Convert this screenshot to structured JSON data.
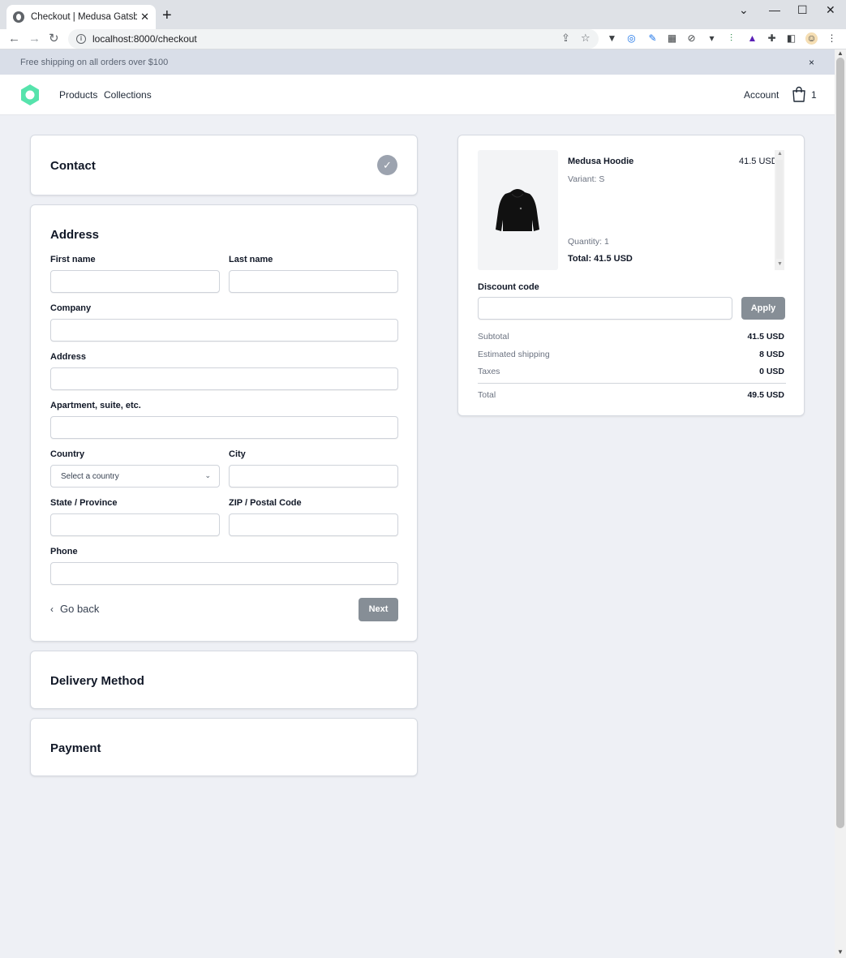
{
  "browser": {
    "tab_title": "Checkout | Medusa Gatsby Starter",
    "tab_close": "✕",
    "new_tab": "+",
    "url": "localhost:8000/checkout",
    "window_controls": [
      "⌄",
      "—",
      "☐",
      "✕"
    ]
  },
  "announcement": {
    "text": "Free shipping on all orders over $100",
    "close": "×"
  },
  "header": {
    "nav": [
      "Products",
      "Collections"
    ],
    "account": "Account",
    "cart_count": "1",
    "logo_color": "#56e3ac"
  },
  "checkout": {
    "contact": {
      "title": "Contact",
      "check": "✓"
    },
    "address": {
      "title": "Address",
      "first_name_label": "First name",
      "last_name_label": "Last name",
      "company_label": "Company",
      "address_label": "Address",
      "apartment_label": "Apartment, suite, etc.",
      "country_label": "Country",
      "country_placeholder": "Select a country",
      "city_label": "City",
      "state_label": "State / Province",
      "zip_label": "ZIP / Postal Code",
      "phone_label": "Phone",
      "go_back": "Go back",
      "next": "Next"
    },
    "delivery": {
      "title": "Delivery Method"
    },
    "payment": {
      "title": "Payment"
    }
  },
  "summary": {
    "item": {
      "name": "Medusa Hoodie",
      "price": "41.5 USD",
      "variant": "Variant: S",
      "quantity": "Quantity: 1",
      "total": "Total: 41.5 USD"
    },
    "discount_label": "Discount code",
    "apply": "Apply",
    "rows": [
      {
        "label": "Subtotal",
        "value": "41.5 USD"
      },
      {
        "label": "Estimated shipping",
        "value": "8 USD"
      },
      {
        "label": "Taxes",
        "value": "0 USD"
      },
      {
        "label": "Total",
        "value": "49.5 USD"
      }
    ]
  },
  "colors": {
    "accent_button": "#868e96",
    "page_bg": "#eef0f5",
    "announce_bg": "#d9dee8"
  }
}
